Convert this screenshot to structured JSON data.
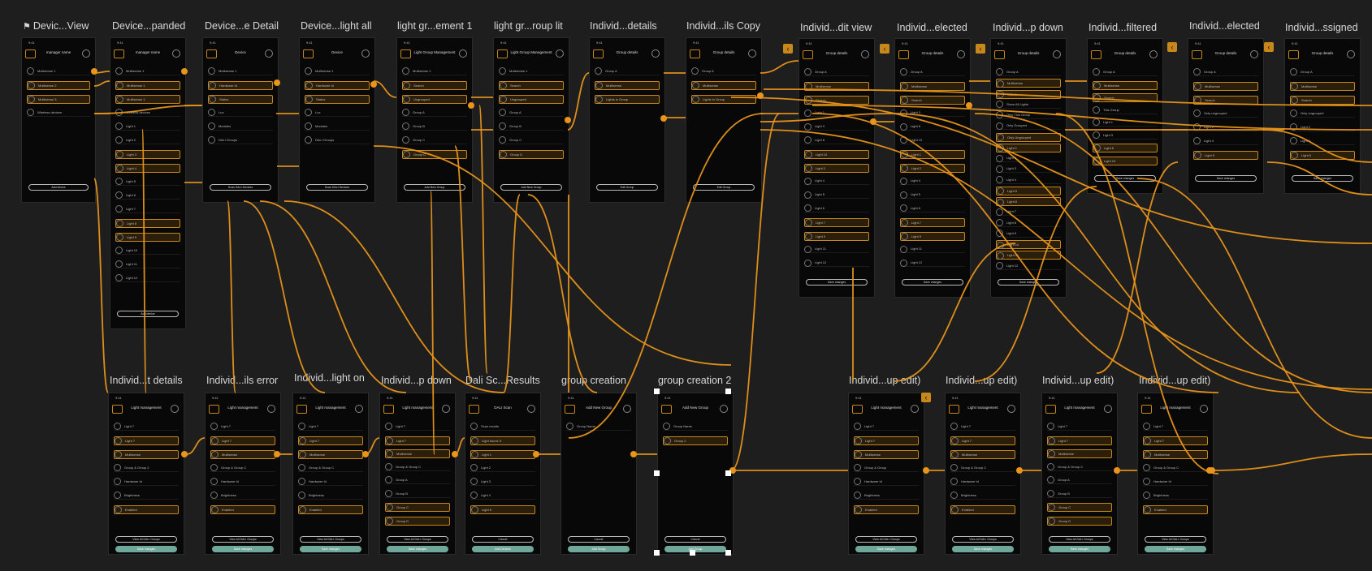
{
  "canvas": {
    "accent": "#e8951a",
    "background": "#1e1e1e",
    "teal": "#6fa89a"
  },
  "top_frames": [
    {
      "title": "Devic...View",
      "flag": true,
      "screen": "manager name",
      "items": [
        "Multisense 1",
        "Multisense 2",
        "Multisense 3",
        "Wireless devices"
      ],
      "button": "Add device"
    },
    {
      "title": "Device...panded",
      "flag": false,
      "screen": "manager name",
      "items": [
        "Multisense 1",
        "Multisense 1",
        "Multisense 1",
        "Wireless devices",
        "Light 1",
        "Light 2",
        "Light 3",
        "Light 4",
        "Light 5",
        "Light 6",
        "Light 7",
        "Light 8",
        "Light 9",
        "Light 10",
        "Light 11",
        "Light 12"
      ],
      "button": "Add device"
    },
    {
      "title": "Device...e Detail",
      "flag": false,
      "screen": "Device",
      "items": [
        "Multisense 1",
        "Hardware Id",
        "Status",
        "Lux",
        "Modules",
        "DALI Groups"
      ],
      "button": "Scan DALI Devices"
    },
    {
      "title": "Device...light all",
      "flag": false,
      "screen": "Device",
      "items": [
        "Multisense 1",
        "Hardware Id",
        "Status",
        "Lux",
        "Modules",
        "DALI Groups"
      ],
      "button": "Scan DALI Devices"
    },
    {
      "title": "light gr...ement 1",
      "flag": false,
      "screen": "Light Group Management",
      "items": [
        "Multisense 1",
        "Search",
        "Ungrouped",
        "Group A",
        "Group B",
        "Group C",
        "Group D"
      ],
      "button": "Add New Group"
    },
    {
      "title": "light gr...roup lit",
      "flag": false,
      "screen": "Light Group Management",
      "items": [
        "Multisense 1",
        "Search",
        "Ungrouped",
        "Group A",
        "Group B",
        "Group C",
        "Group D"
      ],
      "button": "Add New Group"
    },
    {
      "title": "Individ...details",
      "flag": false,
      "screen": "Group details",
      "items": [
        "Group A",
        "Multisense",
        "Lights in Group"
      ],
      "button": "Edit Group"
    },
    {
      "title": "Individ...ils Copy",
      "flag": false,
      "screen": "Group details",
      "items": [
        "Group A",
        "Multisense",
        "Lights in Group"
      ],
      "button": "Edit Group"
    },
    {
      "title": "Individ...dit view",
      "flag": false,
      "screen": "Group details",
      "items": [
        "Group A",
        "Multisense",
        "Search",
        "Light 1",
        "Light 3",
        "Light 8",
        "Light 10",
        "Light 2",
        "Light 4",
        "Light 5",
        "Light 6",
        "Light 7",
        "Light 9",
        "Light 11",
        "Light 12"
      ],
      "button": "Save changes"
    },
    {
      "title": "Individ...elected",
      "flag": false,
      "screen": "Group details",
      "items": [
        "Group A",
        "Multisense",
        "Search",
        "Light 3",
        "Light 8",
        "Light 10",
        "Light 1",
        "Light 2",
        "Light 4",
        "Light 5",
        "Light 6",
        "Light 7",
        "Light 9",
        "Light 11",
        "Light 12"
      ],
      "button": "Save changes"
    },
    {
      "title": "Individ...p down",
      "flag": false,
      "screen": "Group details",
      "items": [
        "Group A",
        "Multisense",
        "Search",
        "Show All Lights",
        "Only This Group",
        "Only Grouped",
        "Only Ungrouped",
        "Light 1",
        "Light 2",
        "Light 3",
        "Light 4",
        "Light 5",
        "Light 6",
        "Light 7",
        "Light 8",
        "Light 9",
        "Light 10",
        "Light 11",
        "Light 12"
      ],
      "button": "Save changes"
    },
    {
      "title": "Individ...filtered",
      "flag": false,
      "screen": "Group details",
      "items": [
        "Group A",
        "Multisense",
        "Search",
        "This Group",
        "Light 1",
        "Light 3",
        "Light 8",
        "Light 10"
      ],
      "button": "Save changes"
    },
    {
      "title": "Individ...elected",
      "flag": false,
      "screen": "Group details",
      "items": [
        "Group A",
        "Multisense",
        "Search",
        "Only ungrouped",
        "Light 2",
        "Light 4",
        "Light 5"
      ],
      "button": "Save changes"
    },
    {
      "title": "Individ...ssigned",
      "flag": false,
      "screen": "Group details",
      "items": [
        "Group A",
        "Multisense",
        "Search",
        "Only ungrouped",
        "Light 2",
        "Light 4",
        "Light 5"
      ],
      "button": "Save changes"
    }
  ],
  "bottom_frames": [
    {
      "title": "Individ...t details",
      "screen": "Light management",
      "items": [
        "Light 7",
        "Light 7",
        "Multisense",
        "Group & Group 2",
        "Hardware Id",
        "Brightness",
        "Enabled"
      ],
      "button": "View All DALI Groups",
      "button2": "Save changes"
    },
    {
      "title": "Individ...ils error",
      "screen": "Light management",
      "items": [
        "Light 7",
        "Light 7",
        "Multisense",
        "Group & Group C",
        "Hardware Id",
        "Brightness",
        "Enabled"
      ],
      "button": "View All DALI Groups",
      "button2": "Save changes"
    },
    {
      "title": "Individ...light on",
      "screen": "Light management",
      "items": [
        "Light 7",
        "Light 7",
        "Multisense",
        "Group & Group C",
        "Hardware Id",
        "Brightness",
        "Enabled"
      ],
      "button": "View All DALI Groups",
      "button2": "Save changes"
    },
    {
      "title": "Individ...p down",
      "screen": "Light management",
      "items": [
        "Light 7",
        "Light 7",
        "Multisense",
        "Group & Group C",
        "Group A",
        "Group B",
        "Group C",
        "Group D"
      ],
      "button": "View All DALI Groups",
      "button2": "Save changes"
    },
    {
      "title": "Dali Sc...Results",
      "screen": "DALI Scan",
      "items": [
        "Scan results",
        "Light found: 5",
        "Light 1",
        "Light 2",
        "Light 3",
        "Light 4",
        "Light 5"
      ],
      "button": "Cancel",
      "button2": "Add Devices"
    },
    {
      "title": "group creation",
      "screen": "Add New Group",
      "items": [
        "Group Name"
      ],
      "button": "Cancel",
      "button2": "Add Group"
    },
    {
      "title": "group creation 2",
      "screen": "Add New Group",
      "items": [
        "Group Name",
        "Group 2"
      ],
      "button": "Cancel",
      "button2": "Add Group"
    },
    {
      "title": "Individ...up edit)",
      "screen": "Light management",
      "items": [
        "Light 7",
        "Light 7",
        "Multisense",
        "Group & Group",
        "Hardware Id",
        "Brightness",
        "Enabled"
      ],
      "button": "View All DALI Groups",
      "button2": "Save changes"
    },
    {
      "title": "Individ...up edit)",
      "screen": "Light management",
      "items": [
        "Light 7",
        "Light 7",
        "Multisense",
        "Group & Group C",
        "Hardware Id",
        "Brightness",
        "Enabled"
      ],
      "button": "View All DALI Groups",
      "button2": "Save changes"
    },
    {
      "title": "Individ...up edit)",
      "screen": "Light management",
      "items": [
        "Light 7",
        "Light 7",
        "Multisense",
        "Group & Group C",
        "Group A",
        "Group B",
        "Group C",
        "Group D"
      ],
      "button": "View All DALI Groups",
      "button2": "Save changes"
    },
    {
      "title": "Individ...up edit)",
      "screen": "Light management",
      "items": [
        "Light 7",
        "Light 7",
        "Multisense",
        "Group & Group C",
        "Hardware Id",
        "Brightness",
        "Enabled"
      ],
      "button": "View All DALI Groups",
      "button2": "Save changes"
    }
  ]
}
